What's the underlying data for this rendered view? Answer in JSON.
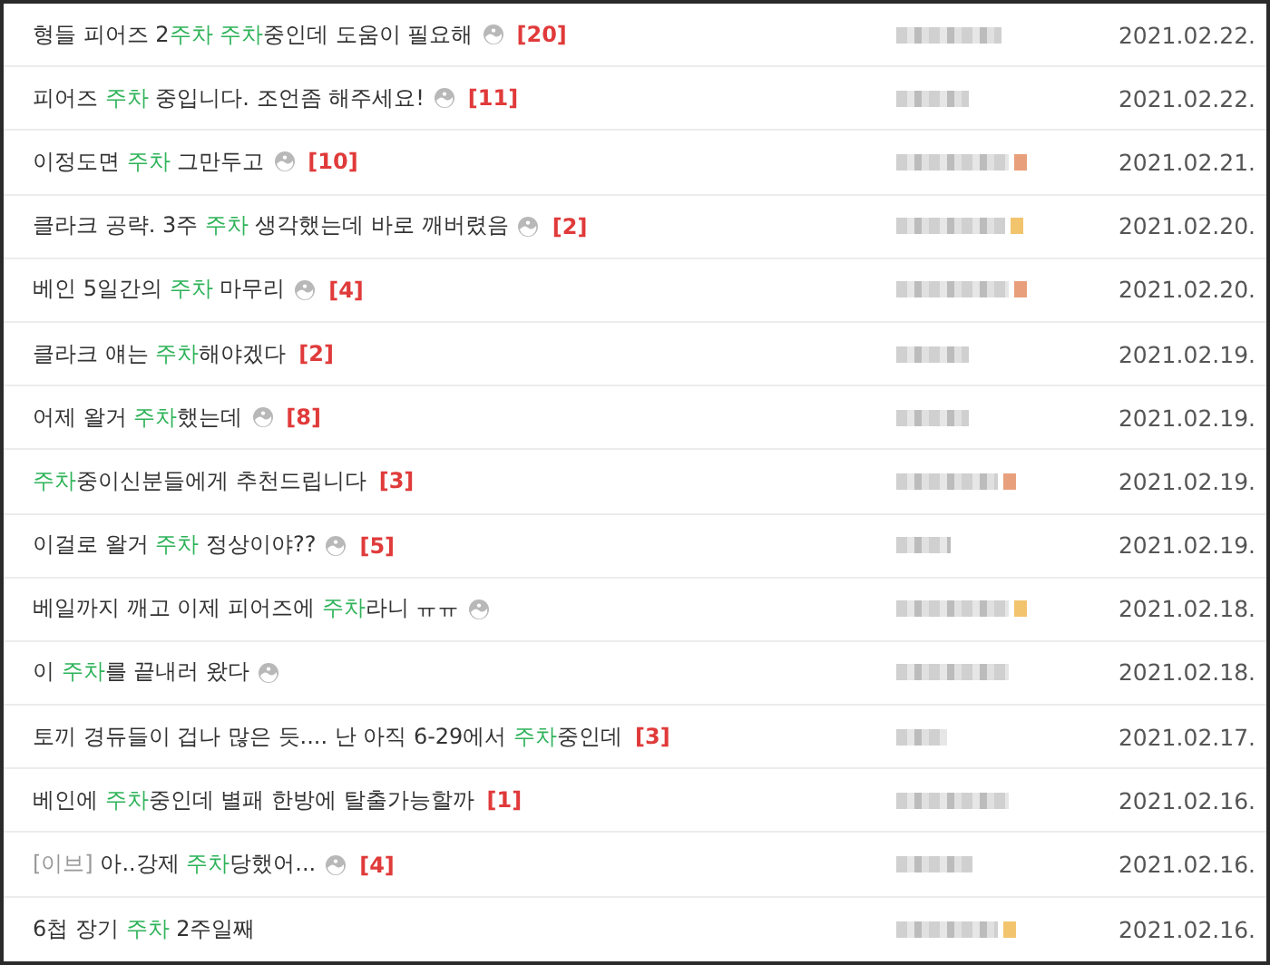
{
  "posts": [
    {
      "title": [
        {
          "kind": "text",
          "text": "형들 피어즈 2"
        },
        {
          "kind": "keyword",
          "text": "주차 주차"
        },
        {
          "kind": "text",
          "text": "중인데 도움이 필요해"
        }
      ],
      "has_image": true,
      "comments": "[20]",
      "date": "2021.02.22."
    },
    {
      "title": [
        {
          "kind": "text",
          "text": "피어즈 "
        },
        {
          "kind": "keyword",
          "text": "주차"
        },
        {
          "kind": "text",
          "text": " 중입니다. 조언좀 해주세요!"
        }
      ],
      "has_image": true,
      "comments": "[11]",
      "date": "2021.02.22."
    },
    {
      "title": [
        {
          "kind": "text",
          "text": "이정도면 "
        },
        {
          "kind": "keyword",
          "text": "주차"
        },
        {
          "kind": "text",
          "text": " 그만두고"
        }
      ],
      "has_image": true,
      "comments": "[10]",
      "color": "#e8a07c",
      "date": "2021.02.21."
    },
    {
      "title": [
        {
          "kind": "text",
          "text": "클라크 공략. 3주 "
        },
        {
          "kind": "keyword",
          "text": "주차"
        },
        {
          "kind": "text",
          "text": " 생각했는데 바로 깨버렸음"
        }
      ],
      "has_image": true,
      "comments": "[2]",
      "color": "#f2c46e",
      "date": "2021.02.20."
    },
    {
      "title": [
        {
          "kind": "text",
          "text": "베인 5일간의 "
        },
        {
          "kind": "keyword",
          "text": "주차"
        },
        {
          "kind": "text",
          "text": " 마무리"
        }
      ],
      "has_image": true,
      "comments": "[4]",
      "color": "#e8a07c",
      "date": "2021.02.20."
    },
    {
      "title": [
        {
          "kind": "text",
          "text": "클라크 얘는 "
        },
        {
          "kind": "keyword",
          "text": "주차"
        },
        {
          "kind": "text",
          "text": "해야겠다"
        }
      ],
      "has_image": false,
      "comments": "[2]",
      "date": "2021.02.19."
    },
    {
      "title": [
        {
          "kind": "text",
          "text": "어제 왈거 "
        },
        {
          "kind": "keyword",
          "text": "주차"
        },
        {
          "kind": "text",
          "text": "했는데"
        }
      ],
      "has_image": true,
      "comments": "[8]",
      "date": "2021.02.19."
    },
    {
      "title": [
        {
          "kind": "keyword",
          "text": "주차"
        },
        {
          "kind": "text",
          "text": "중이신분들에게 추천드립니다"
        }
      ],
      "has_image": false,
      "comments": "[3]",
      "color": "#e8a07c",
      "date": "2021.02.19."
    },
    {
      "title": [
        {
          "kind": "text",
          "text": "이걸로 왈거 "
        },
        {
          "kind": "keyword",
          "text": "주차"
        },
        {
          "kind": "text",
          "text": " 정상이야??"
        }
      ],
      "has_image": true,
      "comments": "[5]",
      "date": "2021.02.19."
    },
    {
      "title": [
        {
          "kind": "text",
          "text": "베일까지 깨고 이제 피어즈에 "
        },
        {
          "kind": "keyword",
          "text": "주차"
        },
        {
          "kind": "text",
          "text": "라니 ㅠㅠ"
        }
      ],
      "has_image": true,
      "color": "#f2c46e",
      "date": "2021.02.18."
    },
    {
      "title": [
        {
          "kind": "text",
          "text": "이 "
        },
        {
          "kind": "keyword",
          "text": "주차"
        },
        {
          "kind": "text",
          "text": "를 끝내러 왔다"
        }
      ],
      "has_image": true,
      "date": "2021.02.18."
    },
    {
      "title": [
        {
          "kind": "text",
          "text": "토끼 경듀들이 겁나 많은 듯.... 난 아직 6-29에서 "
        },
        {
          "kind": "keyword",
          "text": "주차"
        },
        {
          "kind": "text",
          "text": "중인데"
        }
      ],
      "has_image": false,
      "comments": "[3]",
      "date": "2021.02.17."
    },
    {
      "title": [
        {
          "kind": "text",
          "text": "베인에 "
        },
        {
          "kind": "keyword",
          "text": "주차"
        },
        {
          "kind": "text",
          "text": "중인데 별패 한방에 탈출가능할까"
        }
      ],
      "has_image": false,
      "comments": "[1]",
      "date": "2021.02.16."
    },
    {
      "title": [
        {
          "kind": "tag",
          "text": "[이브]"
        },
        {
          "kind": "text",
          "text": " 아..강제 "
        },
        {
          "kind": "keyword",
          "text": "주차"
        },
        {
          "kind": "text",
          "text": "당했어..."
        }
      ],
      "has_image": true,
      "comments": "[4]",
      "date": "2021.02.16."
    },
    {
      "title": [
        {
          "kind": "text",
          "text": "6첩 장기 "
        },
        {
          "kind": "keyword",
          "text": "주차"
        },
        {
          "kind": "text",
          "text": " 2주일째"
        }
      ],
      "has_image": false,
      "color": "#f2c46e",
      "date": "2021.02.16."
    }
  ]
}
